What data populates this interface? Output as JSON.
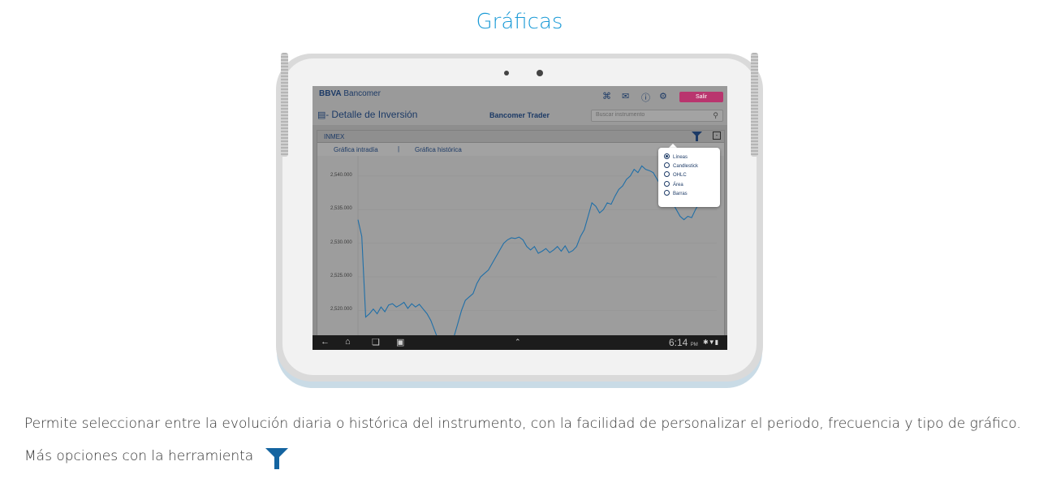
{
  "page": {
    "title": "Gráficas"
  },
  "app": {
    "logo_bold": "BBVA",
    "logo_rest": " Bancomer",
    "header_icons": [
      "share-icon",
      "mail-icon",
      "info-icon",
      "settings-icon"
    ],
    "logout_label": "Salir",
    "screen_title": "Detalle de Inversión",
    "center_label": "Bancomer Trader",
    "search_placeholder": "Buscar instrumento",
    "instrument": "INMEX",
    "tabs": [
      {
        "label": "Gráfica intradía",
        "active": true
      },
      {
        "label": "Gráfica histórica",
        "active": false
      }
    ],
    "chart_type_options": [
      {
        "label": "Líneas",
        "selected": true
      },
      {
        "label": "Candlestick",
        "selected": false
      },
      {
        "label": "OHLC",
        "selected": false
      },
      {
        "label": "Área",
        "selected": false
      },
      {
        "label": "Barras",
        "selected": false
      }
    ],
    "y_ticks": [
      "2,540.000",
      "2,535.000",
      "2,530.000",
      "2,525.000",
      "2,520.000",
      "2,515.000"
    ],
    "clock": "6:14",
    "clock_suffix": "PM",
    "line_color": "#1f6fa8",
    "accent_color": "#b9356e"
  },
  "chart_data": {
    "type": "line",
    "ylim": [
      2514,
      2543
    ],
    "series": [
      {
        "values": [
          2533.5,
          2531.0,
          2519.0,
          2519.5,
          2520.2,
          2519.5,
          2520.5,
          2519.8,
          2520.8,
          2521.0,
          2520.5,
          2520.8,
          2521.2,
          2520.3,
          2521.0,
          2520.5,
          2520.9,
          2520.2,
          2519.5,
          2518.5,
          2517.0,
          2515.5,
          2514.8,
          2514.6,
          2515.0,
          2516.0,
          2518.0,
          2520.0,
          2521.5,
          2522.0,
          2522.5,
          2524.0,
          2525.0,
          2525.5,
          2526.0,
          2527.0,
          2528.0,
          2529.0,
          2530.0,
          2530.5,
          2530.8,
          2530.7,
          2530.9,
          2530.5,
          2529.5,
          2529.0,
          2529.5,
          2528.5,
          2528.8,
          2529.2,
          2528.6,
          2529.0,
          2529.5,
          2528.8,
          2529.6,
          2528.6,
          2528.9,
          2529.5,
          2531.0,
          2532.0,
          2534.0,
          2536.0,
          2535.5,
          2534.5,
          2535.0,
          2536.0,
          2535.8,
          2537.0,
          2538.0,
          2538.5,
          2539.5,
          2540.0,
          2541.0,
          2540.5,
          2541.5,
          2541.0,
          2540.8,
          2540.5,
          2539.5,
          2538.5,
          2538.0,
          2537.0,
          2536.0,
          2535.0,
          2534.0,
          2533.5,
          2534.0,
          2533.8,
          2535.0,
          2536.0,
          2537.0,
          2538.0
        ]
      }
    ]
  },
  "description": {
    "line1": "Permite seleccionar entre  la evolución diaria o histórica del instrumento, con la facilidad de personalizar el periodo, frecuencia y tipo de gráfico.",
    "line2": "Más opciones con la herramienta"
  },
  "filter_color": "#1464a0"
}
